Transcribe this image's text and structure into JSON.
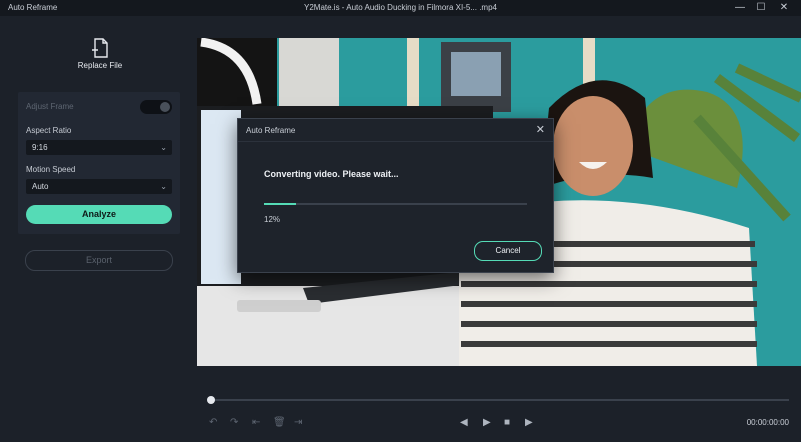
{
  "window": {
    "app_title": "Auto Reframe",
    "file_title": "Y2Mate.is - Auto Audio Ducking in Filmora XI-5... .mp4",
    "minimize_label": "—",
    "maximize_label": "☐",
    "close_label": "✕"
  },
  "sidebar": {
    "replace_file_label": "Replace File",
    "adjust_frame_label": "Adjust Frame",
    "adjust_frame_enabled": false,
    "aspect_ratio_label": "Aspect Ratio",
    "aspect_ratio_value": "9:16",
    "motion_speed_label": "Motion Speed",
    "motion_speed_value": "Auto",
    "analyze_label": "Analyze",
    "export_label": "Export"
  },
  "dialog": {
    "title": "Auto Reframe",
    "close_label": "✕",
    "message": "Converting video. Please wait...",
    "progress_text": "12%",
    "progress_fraction": 0.12,
    "cancel_label": "Cancel"
  },
  "player": {
    "timecode": "00:00:00:00",
    "playhead_fraction": 0.0,
    "icons": [
      "undo-icon",
      "redo-icon",
      "previous-icon",
      "delete-icon",
      "next-icon",
      "step-back-icon",
      "play-icon",
      "stop-icon",
      "step-forward-icon"
    ]
  },
  "colors": {
    "accent": "#55dbb6",
    "background": "#1c2129",
    "panel": "#222833"
  }
}
